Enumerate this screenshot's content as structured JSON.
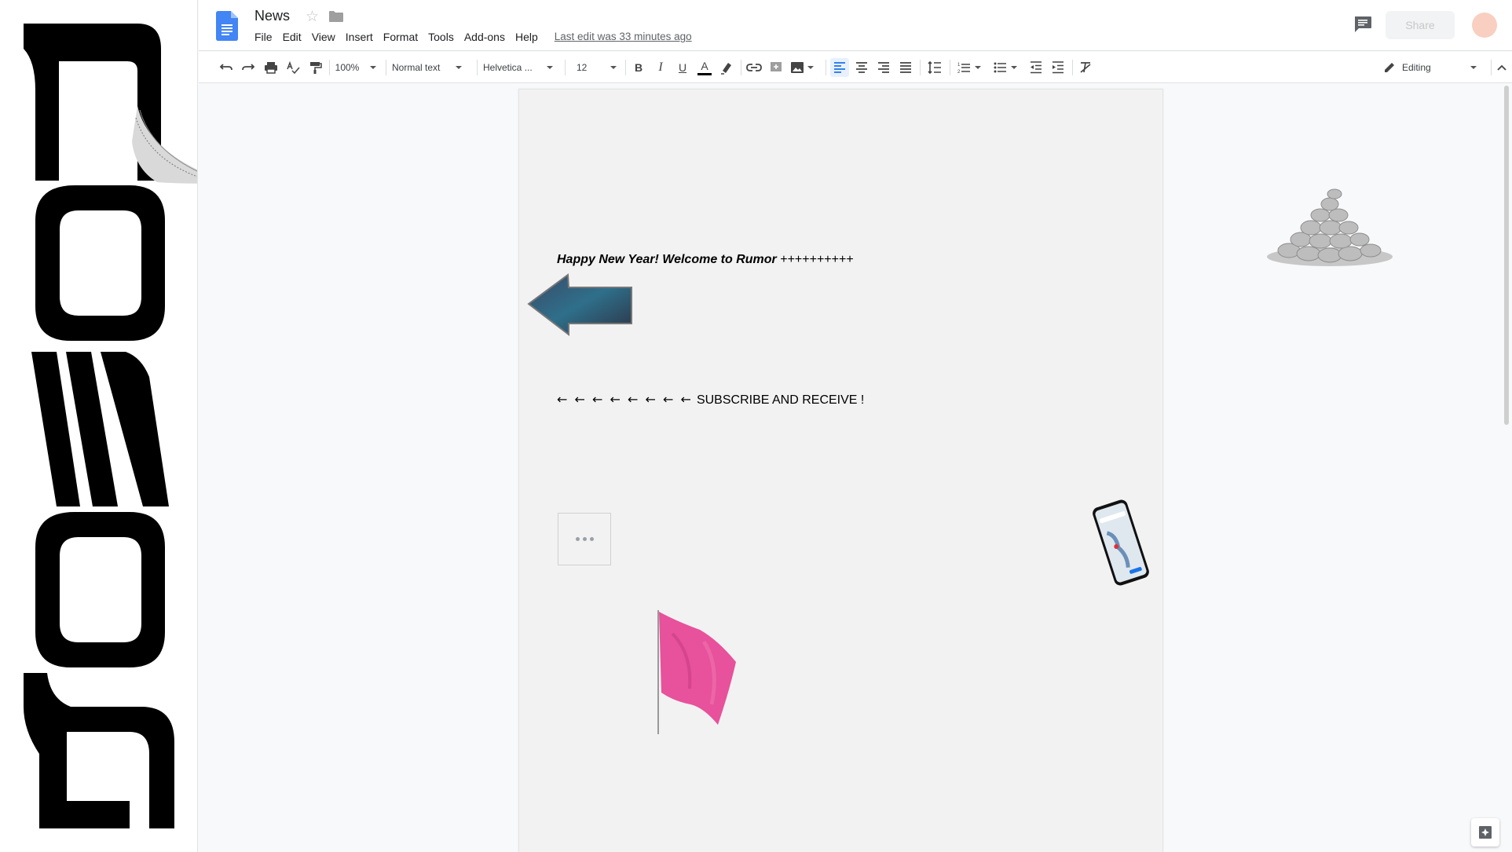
{
  "document": {
    "title": "News",
    "last_edit": "Last edit was 33 minutes ago"
  },
  "menu": [
    {
      "label": "File"
    },
    {
      "label": "Edit"
    },
    {
      "label": "View"
    },
    {
      "label": "Insert"
    },
    {
      "label": "Format"
    },
    {
      "label": "Tools"
    },
    {
      "label": "Add-ons"
    },
    {
      "label": "Help"
    }
  ],
  "header": {
    "share_label": "Share"
  },
  "toolbar": {
    "zoom": "100%",
    "style": "Normal text",
    "font": "Helvetica ...",
    "font_size": "12",
    "mode": "Editing",
    "text_color": "#000000"
  },
  "content": {
    "heading": "Happy New Year! Welcome to Rumor",
    "heading_suffix": "++++++++++",
    "subscribe_arrows": "← ← ← ← ← ← ← ←",
    "subscribe_text": "SUBSCRIBE AND RECEIVE !"
  },
  "icons": {
    "logo": "google-docs-icon",
    "star": "star-icon",
    "folder": "folder-icon",
    "comment": "comment-icon",
    "explore": "explore-icon"
  },
  "colors": {
    "accent": "#4285f4",
    "flag": "#e8519b",
    "avatar": "#f9cfc1"
  }
}
